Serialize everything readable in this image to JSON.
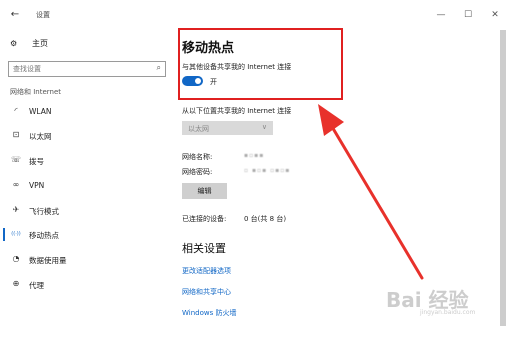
{
  "window": {
    "title": "设置",
    "controls": {
      "back": "←",
      "minimize": "—",
      "maximize": "☐",
      "close": "✕"
    }
  },
  "sidebar": {
    "home": "主页",
    "search_placeholder": "查找设置",
    "section": "网络和 Internet",
    "items": [
      {
        "label": "WLAN",
        "icon": "wifi-icon",
        "glyph": "◜"
      },
      {
        "label": "以太网",
        "icon": "ethernet-icon",
        "glyph": "⊡"
      },
      {
        "label": "拨号",
        "icon": "dialup-icon",
        "glyph": "☏"
      },
      {
        "label": "VPN",
        "icon": "vpn-icon",
        "glyph": "∞"
      },
      {
        "label": "飞行模式",
        "icon": "airplane-icon",
        "glyph": "✈"
      },
      {
        "label": "移动热点",
        "icon": "hotspot-icon",
        "glyph": "((·))"
      },
      {
        "label": "数据使用量",
        "icon": "data-usage-icon",
        "glyph": "◔"
      },
      {
        "label": "代理",
        "icon": "proxy-icon",
        "glyph": "⊕"
      }
    ],
    "active_index": 5
  },
  "main": {
    "title": "移动热点",
    "share_label": "与其他设备共享我的 Internet 连接",
    "toggle_state": "开",
    "toggle_on": true,
    "from_label": "从以下位置共享我的 Internet 连接",
    "source_selected": "以太网",
    "network_name_label": "网络名称:",
    "network_password_label": "网络密码:",
    "network_name_value": "▪▫▪▪",
    "network_password_value": "▫ ▪▫▪ ▫▪▫▪",
    "edit_button": "编辑",
    "connected_label": "已连接的设备:",
    "connected_value": "0 台(共 8 台)",
    "related_title": "相关设置",
    "links": [
      "更改适配器选项",
      "网络和共享中心",
      "Windows 防火墙"
    ]
  },
  "overlay": {
    "watermark": "Bai 经验",
    "watermark_sub": "jingyan.baidu.com",
    "highlight_color": "#e02020",
    "arrow_color": "#e8312b"
  },
  "colors": {
    "accent": "#1167c6",
    "link": "#1167c6"
  }
}
